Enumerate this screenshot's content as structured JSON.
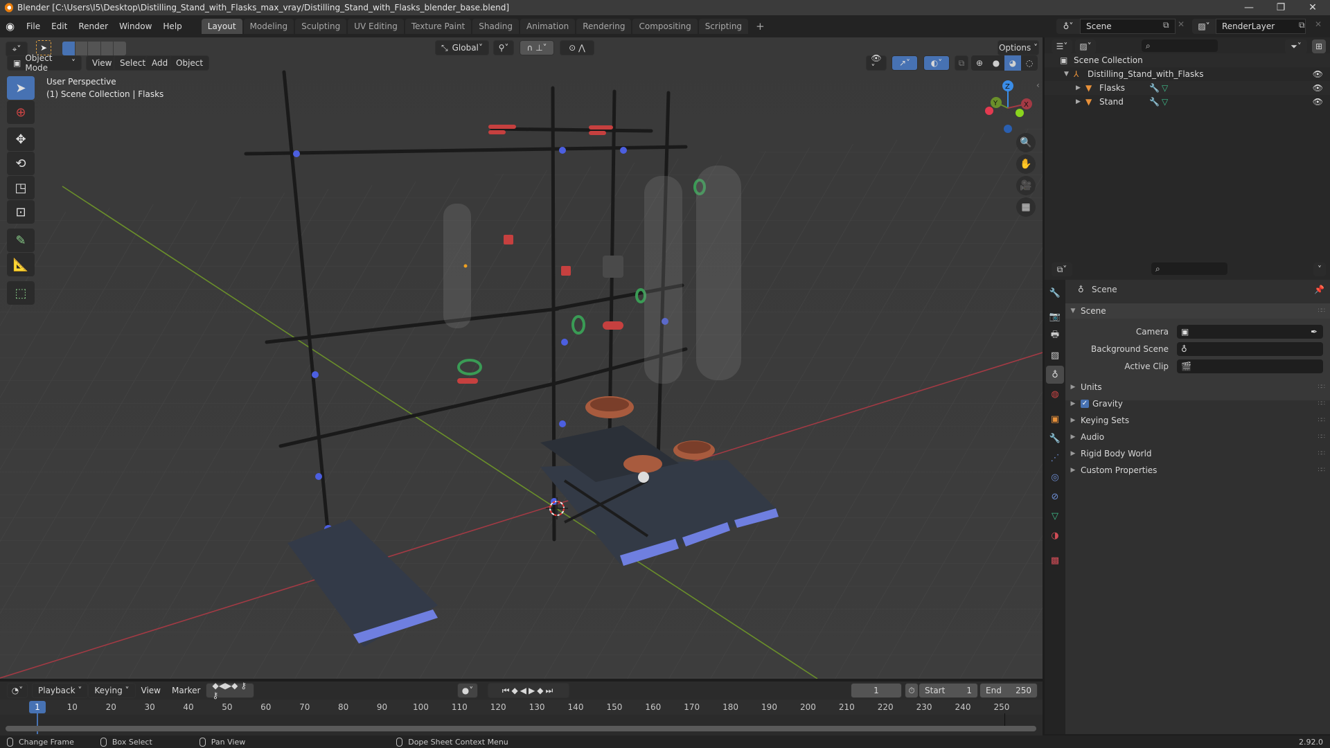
{
  "window": {
    "title": "Blender [C:\\Users\\I5\\Desktop\\Distilling_Stand_with_Flasks_max_vray/Distilling_Stand_with_Flasks_blender_base.blend]",
    "controls": {
      "minimize": "—",
      "maximize": "❐",
      "close": "✕"
    }
  },
  "menubar": {
    "items": [
      "File",
      "Edit",
      "Render",
      "Window",
      "Help"
    ],
    "workspaces": [
      "Layout",
      "Modeling",
      "Sculpting",
      "UV Editing",
      "Texture Paint",
      "Shading",
      "Animation",
      "Rendering",
      "Compositing",
      "Scripting"
    ],
    "active_workspace": "Layout",
    "add_workspace": "+",
    "scene_name": "Scene",
    "view_layer": "RenderLayer"
  },
  "viewport": {
    "mode": "Object Mode",
    "menus": [
      "View",
      "Select",
      "Add",
      "Object"
    ],
    "transform_orientation": "Global",
    "options_label": "Options",
    "overlay_text_line1": "User Perspective",
    "overlay_text_line2": "(1) Scene Collection | Flasks",
    "gizmo_axes": {
      "x": "X",
      "y": "Y",
      "z": "Z"
    },
    "tools": [
      "select-box",
      "cursor",
      "move",
      "rotate",
      "scale",
      "transform",
      "annotate",
      "measure",
      "add-cube"
    ],
    "nav_buttons": [
      "zoom",
      "pan",
      "camera",
      "ortho-grid"
    ],
    "shading_mode": "Solid"
  },
  "outliner": {
    "root": "Scene Collection",
    "collection": "Distilling_Stand_with_Flasks",
    "objects": [
      {
        "name": "Flasks",
        "selected": true
      },
      {
        "name": "Stand",
        "selected": false
      }
    ]
  },
  "properties": {
    "context": "Scene",
    "section_title": "Scene",
    "fields": [
      {
        "label": "Camera",
        "value": ""
      },
      {
        "label": "Background Scene",
        "value": ""
      },
      {
        "label": "Active Clip",
        "value": ""
      }
    ],
    "panels": [
      {
        "label": "Units",
        "checkbox": null
      },
      {
        "label": "Gravity",
        "checkbox": true
      },
      {
        "label": "Keying Sets",
        "checkbox": null
      },
      {
        "label": "Audio",
        "checkbox": null
      },
      {
        "label": "Rigid Body World",
        "checkbox": null
      },
      {
        "label": "Custom Properties",
        "checkbox": null
      }
    ]
  },
  "timeline": {
    "menus": [
      "Playback",
      "Keying",
      "View",
      "Marker"
    ],
    "current_frame": "1",
    "start_label": "Start",
    "start": "1",
    "end_label": "End",
    "end": "250",
    "ticks": [
      "10",
      "20",
      "30",
      "40",
      "50",
      "60",
      "70",
      "80",
      "90",
      "100",
      "110",
      "120",
      "130",
      "140",
      "150",
      "160",
      "170",
      "180",
      "190",
      "200",
      "210",
      "220",
      "230",
      "240",
      "250"
    ],
    "playhead": "1"
  },
  "statusbar": {
    "items": [
      "Change Frame",
      "Box Select",
      "Pan View",
      "Dope Sheet Context Menu"
    ],
    "version": "2.92.0"
  }
}
